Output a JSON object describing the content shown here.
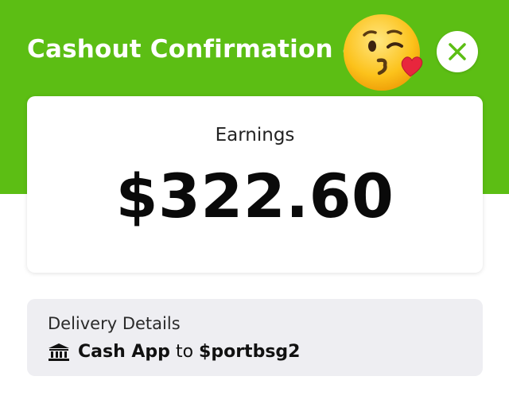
{
  "header": {
    "title": "Cashout Confirmation #",
    "background_color": "#5cbe14",
    "emoji": "kissing-face-with-heart-emoji"
  },
  "close_button": {
    "icon": "close-icon",
    "icon_color": "#5cbe14"
  },
  "earnings": {
    "label": "Earnings",
    "amount": "$322.60"
  },
  "delivery": {
    "label": "Delivery Details",
    "icon": "bank-icon",
    "method": "Cash App",
    "connector": "to",
    "recipient": "$portbsg2"
  }
}
